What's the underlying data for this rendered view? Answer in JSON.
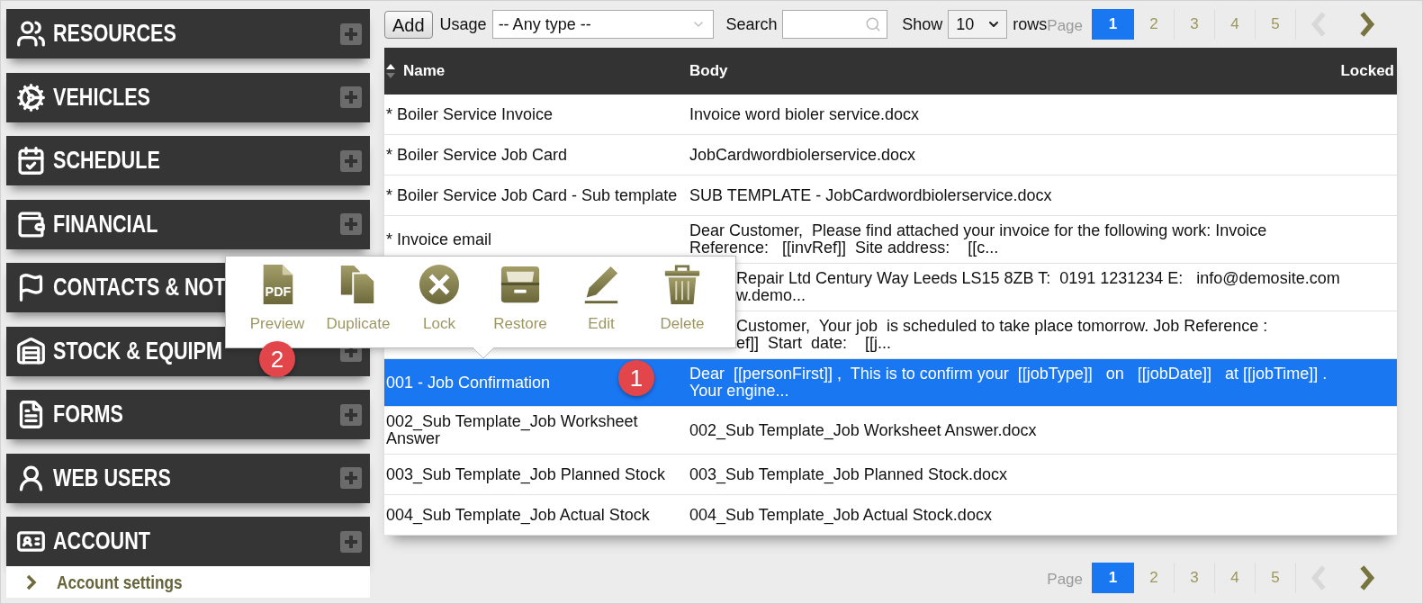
{
  "sidebar": {
    "sections": [
      {
        "label": "RESOURCES",
        "kind": "with_plus"
      },
      {
        "label": "VEHICLES",
        "kind": "with_plus"
      },
      {
        "label": "SCHEDULE",
        "kind": "with_plus"
      },
      {
        "label": "FINANCIAL",
        "kind": "with_plus"
      },
      {
        "label": "CONTACTS & NOT",
        "kind": "no_plus"
      },
      {
        "label": "STOCK & EQUIPM",
        "kind": "with_plus"
      },
      {
        "label": "FORMS",
        "kind": "with_plus"
      },
      {
        "label": "WEB USERS",
        "kind": "with_plus"
      },
      {
        "label": "ACCOUNT",
        "kind": "with_plus",
        "children": [
          {
            "label": "Account settings"
          }
        ]
      }
    ]
  },
  "toolbar": {
    "add_button": "Add",
    "usage": {
      "label": "Usage",
      "value": "-- Any type --"
    },
    "search": {
      "label": "Search"
    },
    "show": {
      "label": "Show",
      "value": "10",
      "suffix": "rows"
    }
  },
  "pagination_top": {
    "label": "Page",
    "pages": [
      {
        "label": "1",
        "selected": true
      },
      {
        "label": "2",
        "selected": false
      },
      {
        "label": "3",
        "selected": false
      },
      {
        "label": "4",
        "selected": false
      },
      {
        "label": "5",
        "selected": false
      }
    ],
    "previous": {
      "disabled": true
    },
    "next": {
      "disabled": false
    }
  },
  "table": {
    "columns": [
      {
        "label": "Name",
        "sorted": true
      },
      {
        "label": "Body"
      },
      {
        "label": "Locked"
      }
    ],
    "rows": [
      {
        "kind": "plain",
        "name": "* Boiler Service Invoice",
        "body": "Invoice word bioler service.docx",
        "selected": false
      },
      {
        "kind": "plain",
        "name": "* Boiler Service Job Card",
        "body": "JobCardwordbiolerservice.docx",
        "selected": false
      },
      {
        "kind": "plain",
        "name": "* Boiler Service Job Card - Sub template",
        "body": "SUB TEMPLATE - JobCardwordbiolerservice.docx",
        "selected": false
      },
      {
        "kind": "plain",
        "name": "* Invoice email",
        "body": "Dear Customer,  Please find attached your invoice for the following work: Invoice Reference:   [[invRef]]  Site address:    [[c...",
        "selected": false
      },
      {
        "kind": "covered",
        "body_fragments": [
          "Repair Ltd Century Way Leeds LS15 8ZB T:  0191 1231234 E:   info@demosite.com",
          "w.demo..."
        ],
        "selected": false
      },
      {
        "kind": "covered",
        "body_fragments": [
          "Customer,  Your job  is scheduled to take place tomorrow. Job Reference :",
          "ef]]  Start  date:    [[j..."
        ],
        "selected": false
      },
      {
        "kind": "plain",
        "name": "001 - Job Confirmation",
        "body": "Dear  [[personFirst]] ,  This is to confirm your  [[jobType]]   on   [[jobDate]]   at [[jobTime]] .  Your engine...",
        "selected": true
      },
      {
        "kind": "plain",
        "name": "002_Sub Template_Job Worksheet Answer",
        "body": "002_Sub Template_Job Worksheet Answer.docx",
        "selected": false
      },
      {
        "kind": "plain",
        "name": "003_Sub Template_Job Planned Stock",
        "body": "003_Sub Template_Job Planned Stock.docx",
        "selected": false
      },
      {
        "kind": "plain",
        "name": "004_Sub Template_Job Actual Stock",
        "body": "004_Sub Template_Job Actual Stock.docx",
        "selected": false
      }
    ]
  },
  "pagination_bottom": {
    "label": "Page",
    "pages": [
      {
        "label": "1",
        "selected": true
      },
      {
        "label": "2",
        "selected": false
      },
      {
        "label": "3",
        "selected": false
      },
      {
        "label": "4",
        "selected": false
      },
      {
        "label": "5",
        "selected": false
      }
    ],
    "previous": {
      "disabled": true
    },
    "next": {
      "disabled": false
    }
  },
  "context_menu": {
    "items": [
      {
        "label": "Preview",
        "icon_text": "PDF"
      },
      {
        "label": "Duplicate"
      },
      {
        "label": "Lock"
      },
      {
        "label": "Restore"
      },
      {
        "label": "Edit"
      },
      {
        "label": "Delete"
      }
    ]
  },
  "markers": [
    {
      "label": "1"
    },
    {
      "label": "2"
    }
  ]
}
